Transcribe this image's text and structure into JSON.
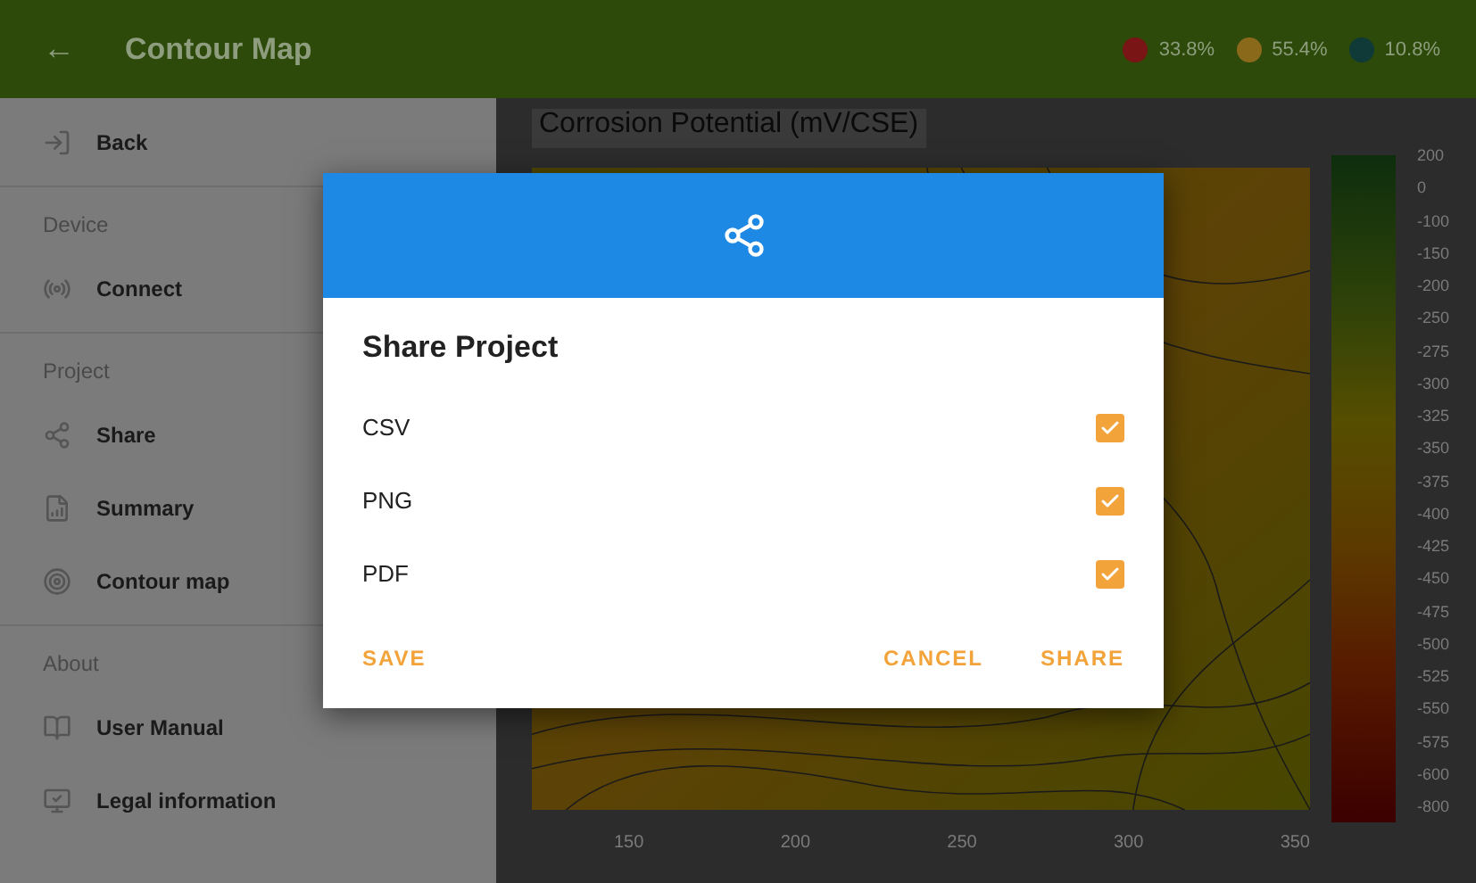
{
  "app_bar": {
    "back": "←",
    "title": "Contour Map",
    "legend": [
      {
        "value": "33.8%",
        "color": "#7a1515"
      },
      {
        "value": "55.4%",
        "color": "#8a6a1a"
      },
      {
        "value": "10.8%",
        "color": "#0f3a38"
      }
    ]
  },
  "drawer": {
    "sections": [
      {
        "items": [
          {
            "label": "Back"
          }
        ]
      },
      {
        "header": "Device",
        "items": [
          {
            "label": "Connect"
          }
        ]
      },
      {
        "header": "Project",
        "items": [
          {
            "label": "Share"
          },
          {
            "label": "Summary"
          },
          {
            "label": "Contour map"
          }
        ]
      },
      {
        "header": "About",
        "items": [
          {
            "label": "User Manual"
          },
          {
            "label": "Legal information"
          }
        ]
      }
    ]
  },
  "map": {
    "title": "Corrosion Potential (mV/CSE)",
    "colorbar_labels": [
      "200",
      "0",
      "-100",
      "-150",
      "-200",
      "-250",
      "-275",
      "-300",
      "-325",
      "-350",
      "-375",
      "-400",
      "-425",
      "-450",
      "-475",
      "-500",
      "-525",
      "-550",
      "-575",
      "-600",
      "-800"
    ],
    "x_ticks": [
      "150",
      "200",
      "250",
      "300",
      "350"
    ]
  },
  "dialog": {
    "title": "Share Project",
    "options": [
      {
        "label": "CSV",
        "checked": true
      },
      {
        "label": "PNG",
        "checked": true
      },
      {
        "label": "PDF",
        "checked": true
      }
    ],
    "buttons": [
      {
        "label": "SAVE",
        "kind": "left"
      },
      {
        "label": "CANCEL",
        "kind": "right"
      },
      {
        "label": "SHARE",
        "kind": "right"
      }
    ]
  }
}
